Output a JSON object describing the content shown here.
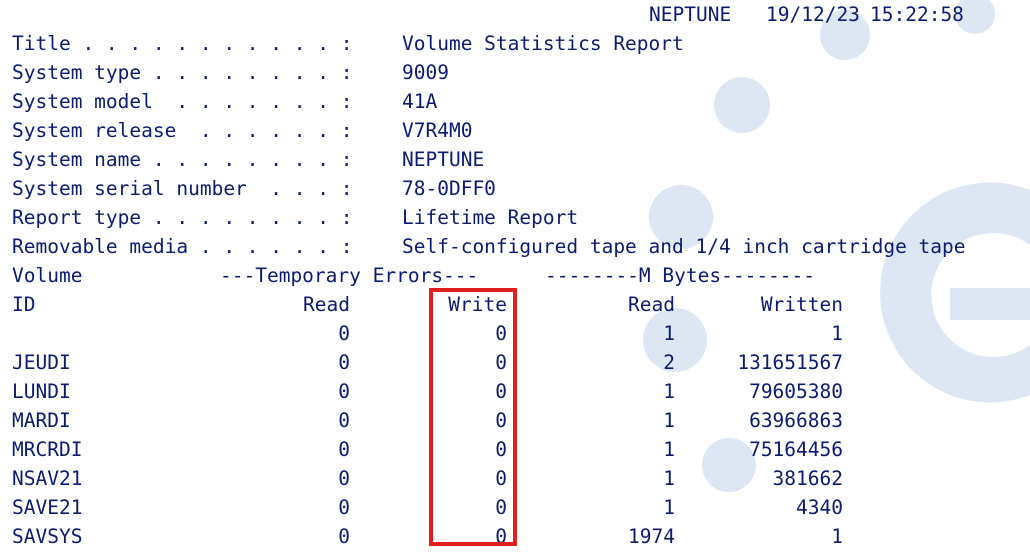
{
  "header": {
    "system": "NEPTUNE",
    "date": "19/12/23",
    "time": "15:22:58"
  },
  "fields": [
    {
      "label": "Title . . . . . . . . . . . :",
      "value": "Volume Statistics Report"
    },
    {
      "label": "System type . . . . . . . . :",
      "value": "9009"
    },
    {
      "label": "System model  . . . . . . . :",
      "value": "41A"
    },
    {
      "label": "System release  . . . . . . :",
      "value": "V7R4M0"
    },
    {
      "label": "System name . . . . . . . . :",
      "value": "NEPTUNE"
    },
    {
      "label": "System serial number  . . . :",
      "value": "78-0DFF0"
    },
    {
      "label": "Report type . . . . . . . . :",
      "value": "Lifetime Report"
    },
    {
      "label": "Removable media . . . . . . :",
      "value": "Self-configured tape and 1/4 inch cartridge tape"
    }
  ],
  "table": {
    "group_header_volume": "Volume",
    "group_header_errors": "---Temporary Errors---",
    "group_header_mbytes": "--------M Bytes--------",
    "col_id": "ID",
    "col_read_err": "Read",
    "col_write_err": "Write",
    "col_read_mb": "Read",
    "col_written_mb": "Written",
    "rows": [
      {
        "id": "",
        "read_err": "0",
        "write_err": "0",
        "read_mb": "1",
        "written_mb": "1"
      },
      {
        "id": "JEUDI",
        "read_err": "0",
        "write_err": "0",
        "read_mb": "2",
        "written_mb": "131651567"
      },
      {
        "id": "LUNDI",
        "read_err": "0",
        "write_err": "0",
        "read_mb": "1",
        "written_mb": "79605380"
      },
      {
        "id": "MARDI",
        "read_err": "0",
        "write_err": "0",
        "read_mb": "1",
        "written_mb": "63966863"
      },
      {
        "id": "MRCRDI",
        "read_err": "0",
        "write_err": "0",
        "read_mb": "1",
        "written_mb": "75164456"
      },
      {
        "id": "NSAV21",
        "read_err": "0",
        "write_err": "0",
        "read_mb": "1",
        "written_mb": "381662"
      },
      {
        "id": "SAVE21",
        "read_err": "0",
        "write_err": "0",
        "read_mb": "1",
        "written_mb": "4340"
      },
      {
        "id": "SAVSYS",
        "read_err": "0",
        "write_err": "0",
        "read_mb": "1974",
        "written_mb": "1"
      }
    ]
  },
  "colors": {
    "text": "#0b1b70",
    "highlight": "#e02020",
    "watermark": "#dde7f4"
  }
}
